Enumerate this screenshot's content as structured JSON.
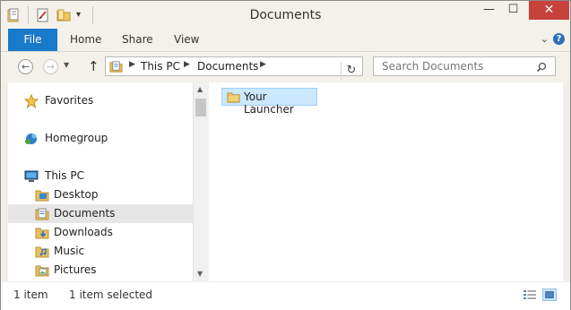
{
  "window": {
    "title": "Documents"
  },
  "title_controls": {
    "minimize": "—",
    "maximize": "☐",
    "close": "✕"
  },
  "ribbon": {
    "tabs": [
      {
        "label": "File"
      },
      {
        "label": "Home"
      },
      {
        "label": "Share"
      },
      {
        "label": "View"
      }
    ],
    "help": "?",
    "expand": "⌄"
  },
  "nav": {
    "back": "←",
    "forward": "→",
    "recent": "▼",
    "up": "↑"
  },
  "address": {
    "segments": [
      "This PC",
      "Documents"
    ],
    "refresh": "↻"
  },
  "search": {
    "placeholder": "Search Documents"
  },
  "sidebar": {
    "items": [
      {
        "label": "Favorites",
        "icon": "star-icon"
      },
      {
        "label": "Homegroup",
        "icon": "homegroup-icon"
      },
      {
        "label": "This PC",
        "icon": "computer-icon"
      },
      {
        "label": "Desktop",
        "icon": "desktop-folder-icon"
      },
      {
        "label": "Documents",
        "icon": "documents-folder-icon",
        "selected": true
      },
      {
        "label": "Downloads",
        "icon": "downloads-folder-icon"
      },
      {
        "label": "Music",
        "icon": "music-folder-icon"
      },
      {
        "label": "Pictures",
        "icon": "pictures-folder-icon"
      }
    ]
  },
  "content": {
    "items": [
      {
        "label": "Your Launcher",
        "icon": "folder-icon",
        "selected": true
      }
    ]
  },
  "status": {
    "count": "1 item",
    "selected": "1 item selected"
  },
  "colors": {
    "accent": "#1979ca",
    "selection": "#cce8ff",
    "close": "#c7423b",
    "folder": "#e8c15a"
  }
}
